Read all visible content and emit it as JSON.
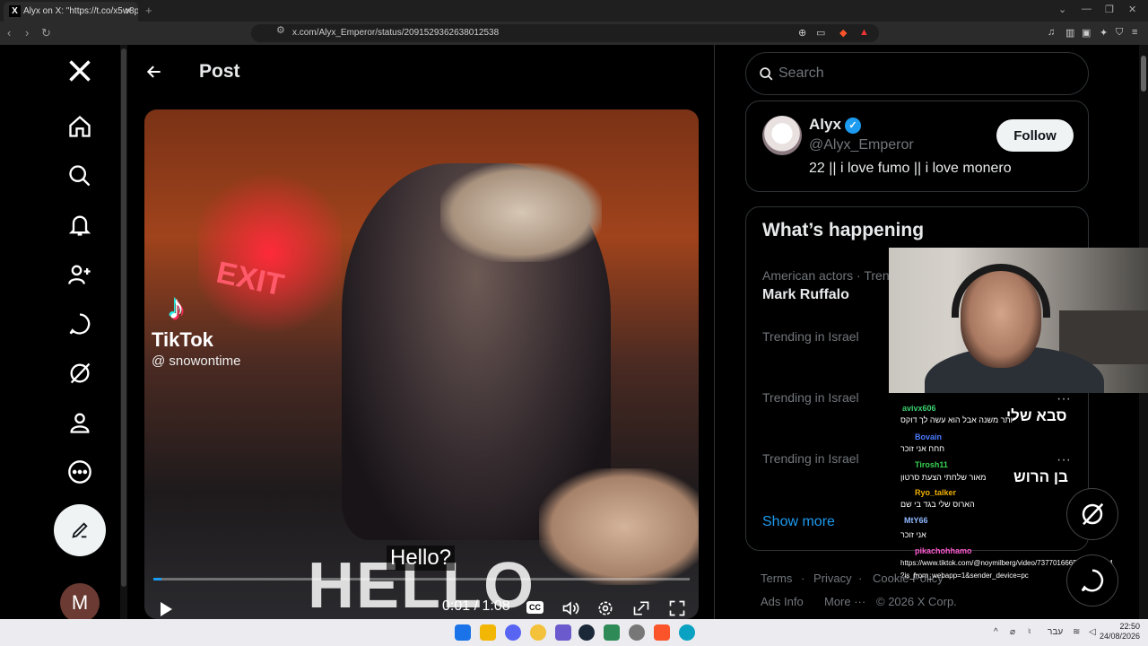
{
  "browser": {
    "tab_title": "Alyx on X: \"https://t.co/x5w8pN...",
    "tab_favicon": "X",
    "new_tab": "+",
    "url": "x.com/Alyx_Emperor/status/2091529362638012538"
  },
  "nav": {
    "post_title": "Post",
    "avatar_letter": "M"
  },
  "video": {
    "exit_sign": "EXIT",
    "tiktok": "TikTok",
    "tiktok_user": "@ snowontime",
    "hello_text": "HELLO",
    "caption": "Hello?",
    "time": "0:01 / 1:08",
    "progress": 0.015,
    "cc": "CC"
  },
  "search": {
    "placeholder": "Search"
  },
  "profile": {
    "name": "Alyx",
    "handle": "@Alyx_Emperor",
    "bio": "22 || i love fumo || i love monero",
    "follow": "Follow"
  },
  "happening": {
    "title": "What’s happening",
    "trends": [
      {
        "meta": "American actors · Trending",
        "name": "Mark Ruffalo"
      },
      {
        "meta": "Trending in Israel",
        "name": ""
      },
      {
        "meta": "Trending in Israel",
        "name": "סבא שלי"
      },
      {
        "meta": "Trending in Israel",
        "name": "בן הרוש"
      }
    ],
    "show_more": "Show more"
  },
  "footer": {
    "terms": "Terms",
    "privacy": "Privacy",
    "cookie": "Cookie Policy",
    "ads": "Ads Info",
    "more": "More ···",
    "copyright": "© 2026 X Corp."
  },
  "chat": {
    "messages": [
      {
        "user": "avivx606",
        "color": "#3cd070",
        "text": "יותר משנה אבל הוא עשה לך דוקס"
      },
      {
        "user": "Bovain",
        "color": "#4a7cff",
        "text": "חחח אני זוכר"
      },
      {
        "user": "Tirosh11",
        "color": "#39d353",
        "text": "מאור שלחתי הצעת סרטון"
      },
      {
        "user": "Ryo_talker",
        "color": "#f0b000",
        "text": "הארוס שלי בגד בי שם"
      },
      {
        "user": "MtY66",
        "color": "#8fb8ff",
        "text": "אני זוכר"
      },
      {
        "user": "pikachohhamo",
        "color": "#ff5ad0",
        "text": "https://www.tiktok.com/@noymilberg/video/7377016665336253704"
      },
      {
        "user": "",
        "color": "#ffffff",
        "text": "?is_from_webapp=1&sender_device=pc"
      }
    ]
  },
  "taskbar": {
    "lang": "עבר",
    "time": "22:50",
    "date": "24/08/2026"
  }
}
